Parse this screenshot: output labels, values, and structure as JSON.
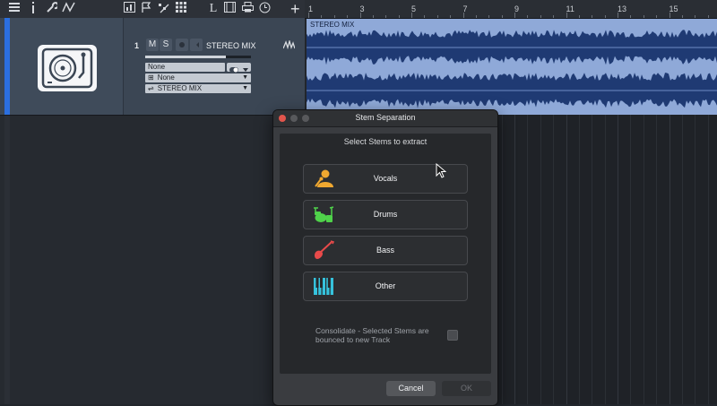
{
  "ruler": {
    "markers": [
      {
        "label": "1"
      },
      {
        "label": "3"
      },
      {
        "label": "5"
      },
      {
        "label": "7"
      },
      {
        "label": "9"
      },
      {
        "label": "11"
      },
      {
        "label": "13"
      },
      {
        "label": "15"
      }
    ]
  },
  "toolbar": {
    "icons": [
      "menu-icon",
      "info-icon",
      "wrench-icon",
      "automation-curve-icon",
      "mixer-icon",
      "flag-icon",
      "note-edit-icon",
      "grid-icon",
      "l-icon",
      "film-icon",
      "print-icon",
      "clock-icon",
      "add-track-icon"
    ],
    "l_glyph": "L",
    "add_glyph": "+"
  },
  "track": {
    "number": "1",
    "mute_label": "M",
    "solo_label": "S",
    "name": "STEREO MIX",
    "volume_level": 0.76,
    "input_value": "None",
    "output_value": "None",
    "routing_value": "STEREO MIX",
    "color": "#2b6fe0",
    "icon": "turntable-icon"
  },
  "clip": {
    "label": "STEREO MIX"
  },
  "dialog": {
    "title": "Stem Separation",
    "subtitle": "Select Stems to extract",
    "stems": [
      {
        "label": "Vocals",
        "icon": "singer-icon",
        "color": "#f0a830"
      },
      {
        "label": "Drums",
        "icon": "drum-kit-icon",
        "color": "#4fd24a"
      },
      {
        "label": "Bass",
        "icon": "bass-guitar-icon",
        "color": "#e84a4a"
      },
      {
        "label": "Other",
        "icon": "keyboard-icon",
        "color": "#36c2dc"
      }
    ],
    "consolidate_text": "Consolidate - Selected Stems are bounced to new Track",
    "consolidate_checked": false,
    "cancel_label": "Cancel",
    "ok_label": "OK"
  }
}
